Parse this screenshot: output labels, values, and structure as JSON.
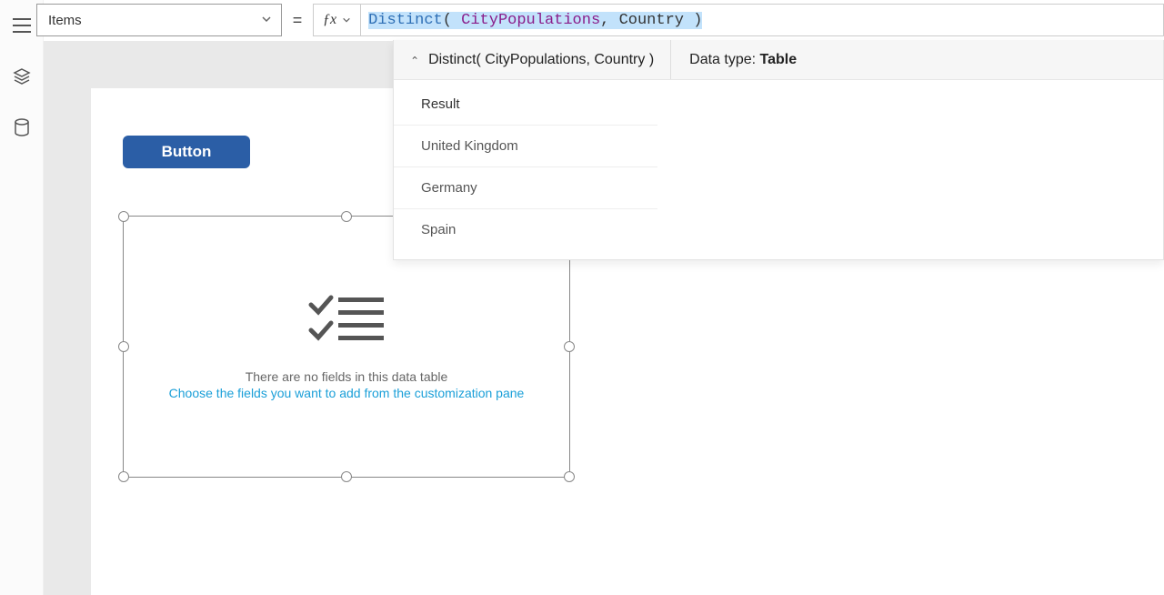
{
  "property_dropdown": {
    "value": "Items"
  },
  "formula": {
    "fn": "Distinct",
    "open": "( ",
    "arg1": "CityPopulations",
    "comma": ", ",
    "arg2": "Country",
    "close": " )"
  },
  "panel": {
    "signature": "Distinct( CityPopulations, Country )",
    "datatype_label": "Data type: ",
    "datatype_value": "Table",
    "results_header": "Result",
    "results": [
      "United Kingdom",
      "Germany",
      "Spain"
    ]
  },
  "canvas": {
    "button_label": "Button",
    "empty_line1": "There are no fields in this data table",
    "empty_line2": "Choose the fields you want to add from the customization pane"
  }
}
